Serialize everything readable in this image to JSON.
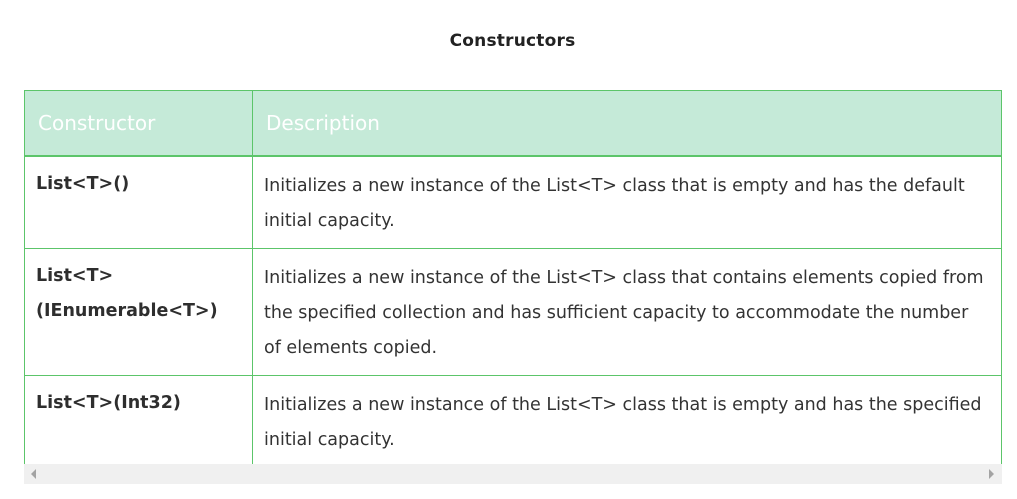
{
  "caption": "Constructors",
  "table": {
    "headers": {
      "constructor": "Constructor",
      "description": "Description"
    },
    "rows": [
      {
        "constructor": "List<T>()",
        "description": "Initializes a new instance of the List<T> class that is empty and has the default initial capacity."
      },
      {
        "constructor": "List<T>(IEnumerable<T>)",
        "description": "Initializes a new instance of the List<T> class that contains elements copied from the specified collection and has sufficient capacity to accommodate the number of elements copied."
      },
      {
        "constructor": "List<T>(Int32)",
        "description": "Initializes a new instance of the List<T> class that is empty and has the specified initial capacity."
      }
    ]
  },
  "scrollbar": {
    "left_icon": "triangle-left-icon",
    "right_icon": "triangle-right-icon"
  },
  "colors": {
    "header_bg": "#c5ead8",
    "border": "#5cc56a",
    "header_text": "#ffffff"
  }
}
